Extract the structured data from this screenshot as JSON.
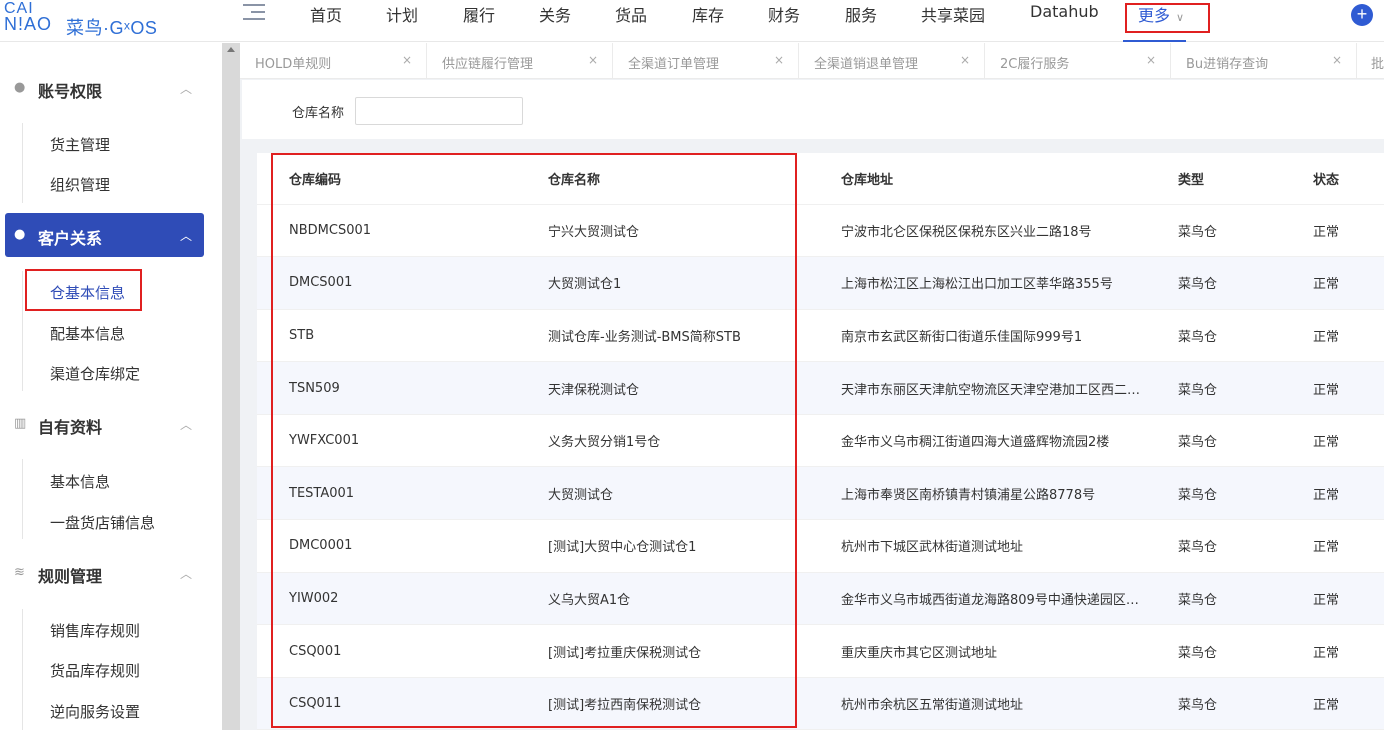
{
  "logo": {
    "top": "CAI",
    "bottom": "N!AO",
    "brand": "菜鸟·GˣOS"
  },
  "nav": {
    "items": [
      "首页",
      "计划",
      "履行",
      "关务",
      "货品",
      "库存",
      "财务",
      "服务",
      "共享菜园",
      "Datahub"
    ],
    "more_label": "更多",
    "plus_label": "+"
  },
  "sidebar": {
    "sections": [
      {
        "label": "账号权限",
        "icon": "person-icon",
        "items": [
          "货主管理",
          "组织管理"
        ]
      },
      {
        "label": "客户关系",
        "icon": "users-icon",
        "items": [
          "仓基本信息",
          "配基本信息",
          "渠道仓库绑定"
        ],
        "active": true
      },
      {
        "label": "自有资料",
        "icon": "books-icon",
        "items": [
          "基本信息",
          "一盘货店铺信息"
        ]
      },
      {
        "label": "规则管理",
        "icon": "layers-icon",
        "items": [
          "销售库存规则",
          "货品库存规则",
          "逆向服务设置"
        ]
      }
    ],
    "current_item": "仓基本信息"
  },
  "tabs": [
    "HOLD单规则",
    "供应链履行管理",
    "全渠道订单管理",
    "全渠道销退单管理",
    "2C履行服务",
    "Bu进销存查询",
    "批"
  ],
  "tab_close": "×",
  "filter": {
    "label": "仓库名称",
    "value": "",
    "placeholder": ""
  },
  "table": {
    "headers": [
      "仓库编码",
      "仓库名称",
      "仓库地址",
      "类型",
      "状态"
    ],
    "rows": [
      [
        "NBDMCS001",
        "宁兴大贸测试仓",
        "宁波市北仑区保税区保税东区兴业二路18号",
        "菜鸟仓",
        "正常"
      ],
      [
        "DMCS001",
        "大贸测试仓1",
        "上海市松江区上海松江出口加工区莘华路355号",
        "菜鸟仓",
        "正常"
      ],
      [
        "STB",
        "测试仓库-业务测试-BMS简称STB",
        "南京市玄武区新街口街道乐佳国际999号1",
        "菜鸟仓",
        "正常"
      ],
      [
        "TSN509",
        "天津保税测试仓",
        "天津市东丽区天津航空物流区天津空港加工区西二…",
        "菜鸟仓",
        "正常"
      ],
      [
        "YWFXC001",
        "义务大贸分销1号仓",
        "金华市义乌市稠江街道四海大道盛辉物流园2楼",
        "菜鸟仓",
        "正常"
      ],
      [
        "TESTA001",
        "大贸测试仓",
        "上海市奉贤区南桥镇青村镇浦星公路8778号",
        "菜鸟仓",
        "正常"
      ],
      [
        "DMC0001",
        "[测试]大贸中心仓测试仓1",
        "杭州市下城区武林街道测试地址",
        "菜鸟仓",
        "正常"
      ],
      [
        "YIW002",
        "义乌大贸A1仓",
        "金华市义乌市城西街道龙海路809号中通快递园区…",
        "菜鸟仓",
        "正常"
      ],
      [
        "CSQ001",
        "[测试]考拉重庆保税测试仓",
        "重庆重庆市其它区测试地址",
        "菜鸟仓",
        "正常"
      ],
      [
        "CSQ011",
        "[测试]考拉西南保税测试仓",
        "杭州市余杭区五常街道测试地址",
        "菜鸟仓",
        "正常"
      ]
    ]
  },
  "colors": {
    "primary": "#2f4cb7",
    "link": "#2f5bd3",
    "highlight_box": "#e02020",
    "row_stripe": "#f5f7fd"
  }
}
